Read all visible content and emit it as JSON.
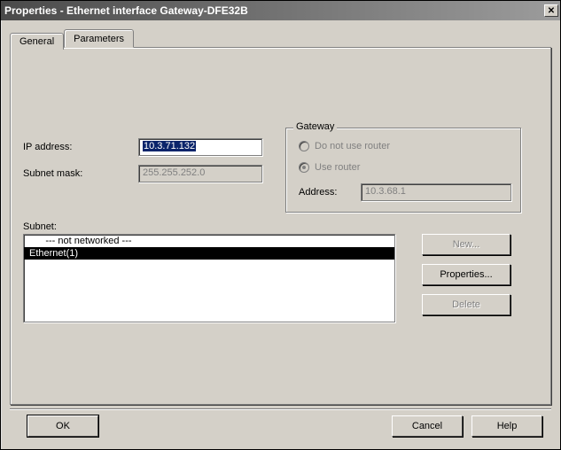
{
  "title": "Properties - Ethernet interface  Gateway-DFE32B",
  "tabs": {
    "general": "General",
    "parameters": "Parameters"
  },
  "labels": {
    "ip_address": "IP address:",
    "subnet_mask": "Subnet mask:",
    "subnet": "Subnet:"
  },
  "values": {
    "ip_address": "10.3.71.132",
    "subnet_mask": "255.255.252.0"
  },
  "gateway": {
    "legend": "Gateway",
    "no_router": "Do not use router",
    "use_router": "Use router",
    "address_label": "Address:",
    "address_value": "10.3.68.1",
    "selected": "use_router"
  },
  "subnet_list": {
    "items": [
      "      --- not networked ---",
      "Ethernet(1)"
    ],
    "selected_index": 1
  },
  "buttons": {
    "new": "New...",
    "properties": "Properties...",
    "delete": "Delete",
    "ok": "OK",
    "cancel": "Cancel",
    "help": "Help"
  }
}
